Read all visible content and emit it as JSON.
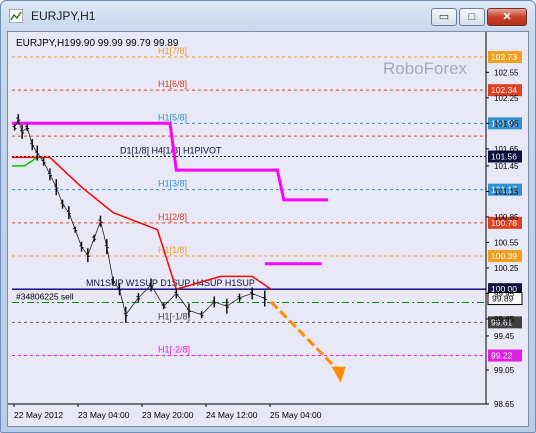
{
  "window": {
    "title": "EURJPY,H1",
    "buttons": {
      "minimize": "▭",
      "maximize": "□",
      "close": "✕"
    }
  },
  "chart_header": {
    "symbol_timeframe": "EURJPY,H1",
    "ohlc": "99.90 99.99 99.79 99.89"
  },
  "watermark": "RoboForex",
  "colors": {
    "background": "#E8E8F6",
    "price_bars": "#000000",
    "trend_red": "#FF0000",
    "trend_green": "#00C800",
    "murrey_magenta": "#FF00FF",
    "arrow": "#FF8C00"
  },
  "chart_data": {
    "type": "line",
    "symbol": "EURJPY",
    "timeframe": "H1",
    "y_range": [
      98.65,
      102.93
    ],
    "y_ticks": [
      "102.55",
      "102.25",
      "101.95",
      "101.65",
      "101.45",
      "101.15",
      "100.85",
      "100.55",
      "100.25",
      "99.95",
      "99.65",
      "99.45",
      "99.05",
      "98.65"
    ],
    "x_ticks": [
      "22 May 2012",
      "23 May 04:00",
      "23 May 20:00",
      "24 May 12:00",
      "25 May 04:00"
    ],
    "levels": [
      {
        "label": "H1[7/8]",
        "price": 102.73,
        "tag": "102.73",
        "color": "#F0A020",
        "label_color": "#F0A020",
        "tag_bg": "#F0A020",
        "tag_fg": "#ffffff"
      },
      {
        "label": "H1[6/8]",
        "price": 102.34,
        "tag": "102.34",
        "color": "#E04020",
        "label_color": "#E04020",
        "tag_bg": "#E04020",
        "tag_fg": "#ffffff"
      },
      {
        "label": "H1[5/8]",
        "price": 101.95,
        "tag": "101.95",
        "color": "#3090D0",
        "label_color": "#3090D0",
        "tag_bg": "#3090D0",
        "tag_fg": "#ffffff"
      },
      {
        "label": "",
        "price": 101.8,
        "tag": "",
        "color": "#D05030",
        "label_color": "#D05030",
        "tag_bg": "",
        "tag_fg": ""
      },
      {
        "label": "D1[1/8] H4[1/8] H1PIVOT",
        "price": 101.56,
        "tag": "101.56",
        "color": "#101010",
        "label_color": "#101040",
        "tag_bg": "#101040",
        "tag_fg": "#ffffff"
      },
      {
        "label": "H1[3/8]",
        "price": 101.17,
        "tag": "101.17",
        "color": "#3090D0",
        "label_color": "#3090D0",
        "tag_bg": "#3090D0",
        "tag_fg": "#ffffff"
      },
      {
        "label": "H1[2/8]",
        "price": 100.78,
        "tag": "100.78",
        "color": "#E04020",
        "label_color": "#E04020",
        "tag_bg": "#E04020",
        "tag_fg": "#ffffff"
      },
      {
        "label": "H1[1/8]",
        "price": 100.39,
        "tag": "100.39",
        "color": "#F0A020",
        "label_color": "#F0A020",
        "tag_bg": "#F0A020",
        "tag_fg": "#ffffff"
      },
      {
        "label": "MN1SUP W1SUP D1SUP H4SUP H1SUP",
        "price": 100.0,
        "tag": "100.00",
        "color": "#000080",
        "label_color": "#101040",
        "tag_bg": "#101040",
        "tag_fg": "#ffffff"
      },
      {
        "label": "H1[-1/8]",
        "price": 99.61,
        "tag": "99.61",
        "color": "#606060",
        "label_color": "#404040",
        "tag_bg": "#404040",
        "tag_fg": "#ffffff"
      },
      {
        "label": "H1[-2/8]",
        "price": 99.22,
        "tag": "99.22",
        "color": "#E020E0",
        "label_color": "#E020E0",
        "tag_bg": "#E020E0",
        "tag_fg": "#ffffff"
      }
    ],
    "current_price": {
      "value": 99.89,
      "tag": "99.89"
    },
    "order_line": {
      "label": "#34806225 sell",
      "price": 99.89
    },
    "magenta_steps": [
      [
        22.0,
        101.95
      ],
      [
        23.25,
        101.95
      ],
      [
        23.3,
        101.4
      ],
      [
        24.1,
        101.4
      ],
      [
        24.15,
        101.05
      ],
      [
        24.5,
        101.05
      ],
      [
        24.0,
        100.3
      ],
      [
        24.45,
        100.3
      ]
    ],
    "trend_line_red": [
      [
        22.0,
        101.55
      ],
      [
        22.3,
        101.55
      ],
      [
        22.55,
        101.2
      ],
      [
        22.8,
        100.9
      ],
      [
        23.15,
        100.7
      ],
      [
        23.3,
        100.0
      ],
      [
        23.65,
        100.15
      ],
      [
        23.9,
        100.15
      ],
      [
        24.05,
        100.0
      ]
    ],
    "trend_line_green": [
      [
        22.0,
        101.45
      ],
      [
        22.1,
        101.45
      ],
      [
        22.2,
        101.55
      ]
    ],
    "price_path": [
      [
        22.02,
        101.9
      ],
      [
        22.05,
        102.0
      ],
      [
        22.08,
        101.85
      ],
      [
        22.12,
        101.9
      ],
      [
        22.16,
        101.7
      ],
      [
        22.2,
        101.6
      ],
      [
        22.25,
        101.5
      ],
      [
        22.3,
        101.35
      ],
      [
        22.35,
        101.2
      ],
      [
        22.4,
        101.0
      ],
      [
        22.45,
        100.9
      ],
      [
        22.5,
        100.7
      ],
      [
        22.55,
        100.5
      ],
      [
        22.6,
        100.4
      ],
      [
        22.65,
        100.6
      ],
      [
        22.7,
        100.8
      ],
      [
        22.75,
        100.5
      ],
      [
        22.8,
        100.1
      ],
      [
        22.85,
        100.0
      ],
      [
        22.9,
        99.7
      ],
      [
        23.0,
        99.9
      ],
      [
        23.1,
        100.05
      ],
      [
        23.2,
        99.8
      ],
      [
        23.3,
        99.95
      ],
      [
        23.4,
        99.75
      ],
      [
        23.5,
        99.7
      ],
      [
        23.6,
        99.85
      ],
      [
        23.7,
        99.8
      ],
      [
        23.8,
        99.9
      ],
      [
        23.9,
        99.95
      ],
      [
        24.0,
        99.89
      ]
    ],
    "forecast_arrow": {
      "from": [
        24.05,
        99.85
      ],
      "to": [
        24.6,
        98.9
      ]
    }
  }
}
